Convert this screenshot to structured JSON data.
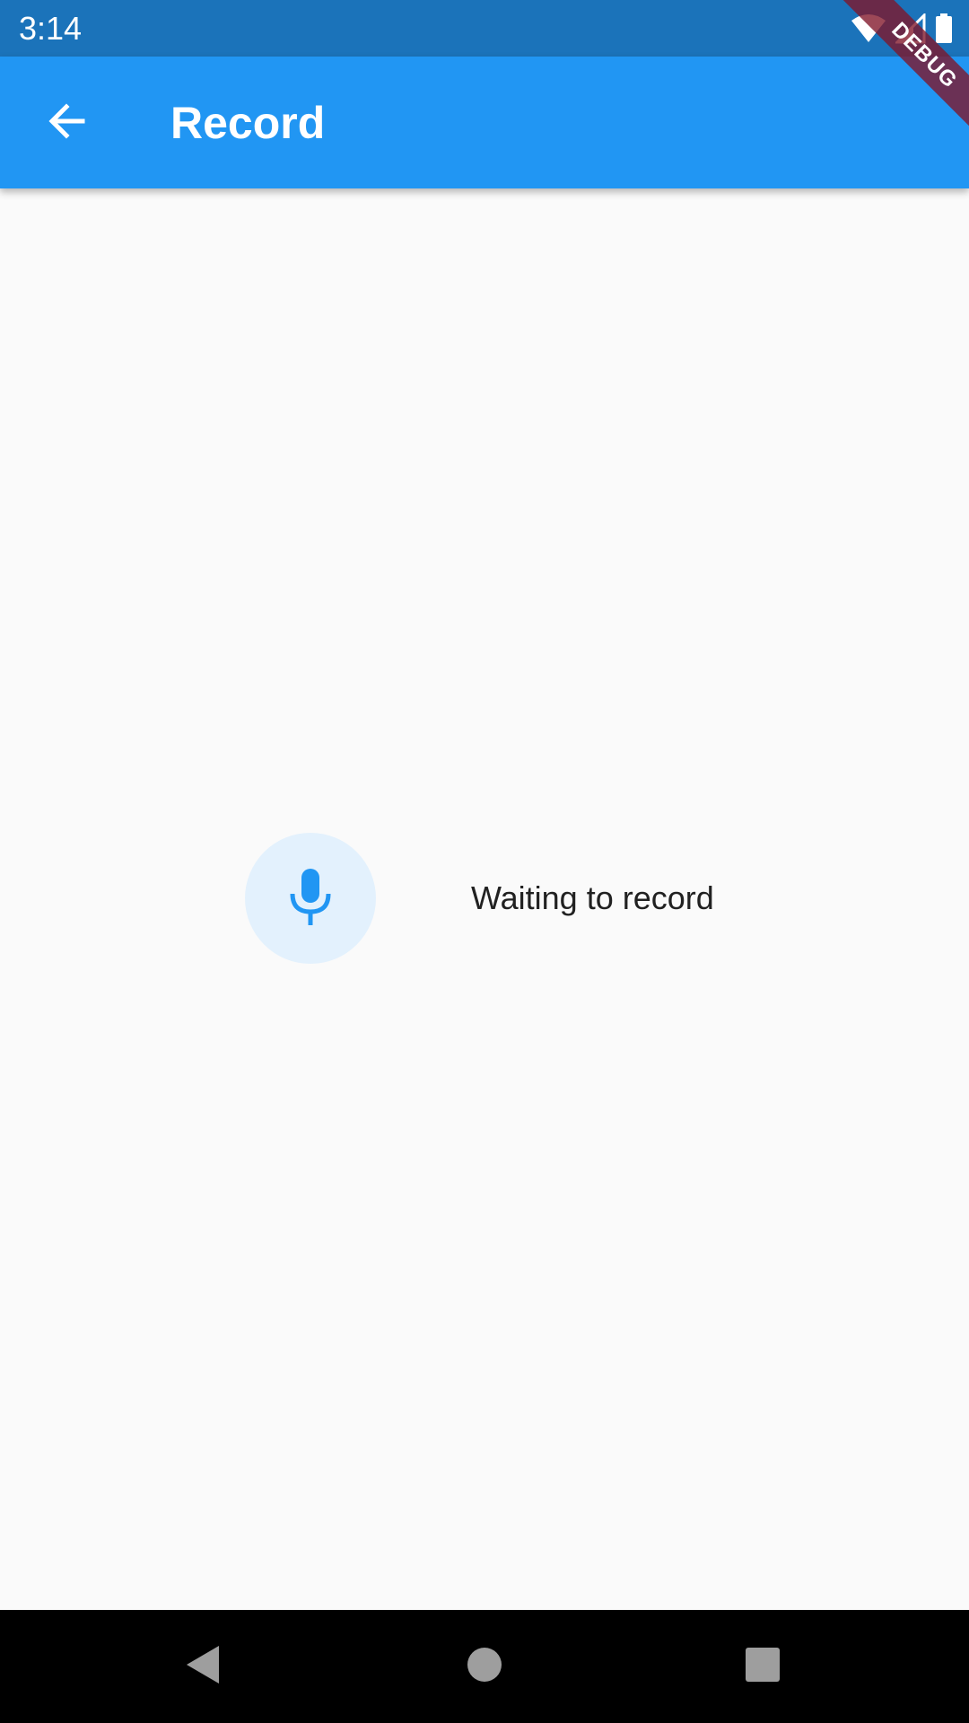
{
  "status_bar": {
    "time": "3:14",
    "icons": [
      "wifi-icon",
      "cell-signal-icon",
      "battery-icon"
    ]
  },
  "debug_banner": {
    "label": "DEBUG"
  },
  "app_bar": {
    "back_icon": "arrow-back-icon",
    "title": "Record"
  },
  "recorder": {
    "mic_icon": "mic-icon",
    "status_text": "Waiting to record"
  },
  "nav_bar": {
    "icons": [
      "nav-back-icon",
      "nav-home-icon",
      "nav-recents-icon"
    ]
  },
  "colors": {
    "status_bar": "#1b73ba",
    "app_bar": "#2196f3",
    "mic_bg": "#e3f1fd",
    "mic_icon": "#2196f3",
    "background": "#fafafa"
  }
}
